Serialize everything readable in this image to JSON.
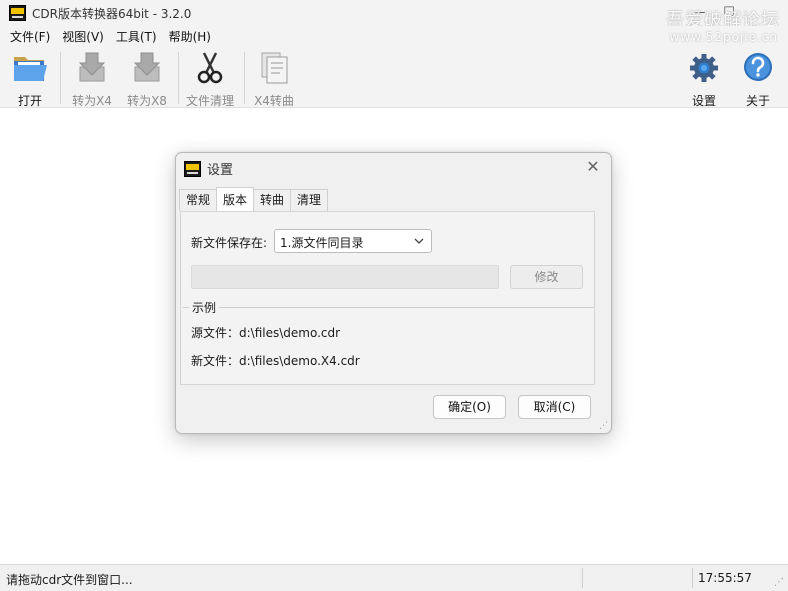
{
  "window": {
    "title": "CDR版本转换器64bit - 3.2.0",
    "minimize_glyph": "—",
    "maximize_glyph": "☐",
    "app_icon": "cdr-version-logo"
  },
  "watermark": {
    "line1": "吾爱破解论坛",
    "line2": "www.52pojie.cn"
  },
  "menu": [
    "文件(F)",
    "视图(V)",
    "工具(T)",
    "帮助(H)"
  ],
  "toolbar": {
    "open": {
      "label": "打开",
      "icon": "folder-open-icon"
    },
    "to_x4": {
      "label": "转为X4",
      "icon": "convert-down-arrow-icon",
      "enabled": false
    },
    "to_x8": {
      "label": "转为X8",
      "icon": "convert-down-arrow-icon",
      "enabled": false
    },
    "clean": {
      "label": "文件清理",
      "icon": "scissors-icon",
      "enabled": false
    },
    "x4_curve": {
      "label": "X4转曲",
      "icon": "documents-icon",
      "enabled": false
    },
    "settings": {
      "label": "设置",
      "icon": "gear-icon"
    },
    "about": {
      "label": "关于",
      "icon": "help-icon"
    }
  },
  "dialog": {
    "title": "设置",
    "close_glyph": "✕",
    "tabs": [
      {
        "label": "常规",
        "active": false
      },
      {
        "label": "版本",
        "active": true
      },
      {
        "label": "转曲",
        "active": false
      },
      {
        "label": "清理",
        "active": false
      }
    ],
    "save_location_label": "新文件保存在:",
    "save_location_value": "1.源文件同目录",
    "path_value": "",
    "modify_button": "修改",
    "example": {
      "legend": "示例",
      "source_line": "源文件：d:\\files\\demo.cdr",
      "new_line": "新文件：d:\\files\\demo.X4.cdr"
    },
    "ok_button": "确定(O)",
    "cancel_button": "取消(C)"
  },
  "status": {
    "message": "请拖动cdr文件到窗口...",
    "time": "17:55:57"
  },
  "colors": {
    "chrome_bg": "#f3f3f3",
    "accent_blue": "#2f7fd0",
    "logo_yellow": "#f2c400"
  }
}
